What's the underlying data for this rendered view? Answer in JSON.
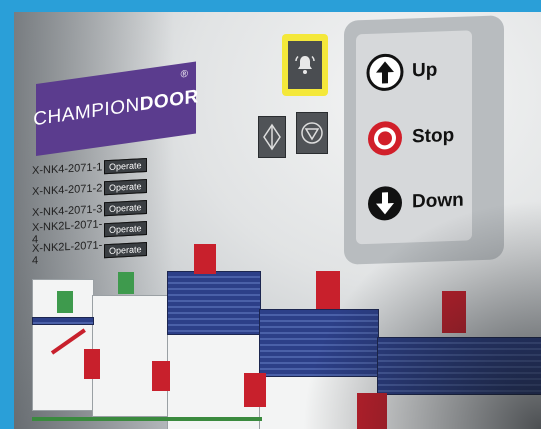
{
  "brand": {
    "name_part1": "CHAMPION",
    "name_part2": "DOOR",
    "registered": "®"
  },
  "devices": [
    {
      "name": "X-NK4-2071-1",
      "button": "Operate"
    },
    {
      "name": "X-NK4-2071-2",
      "button": "Operate"
    },
    {
      "name": "X-NK4-2071-3",
      "button": "Operate"
    },
    {
      "name": "X-NK2L-2071-4",
      "button": "Operate"
    },
    {
      "name": "X-NK2L-2071-4",
      "button": "Operate"
    }
  ],
  "controls": {
    "up": "Up",
    "stop": "Stop",
    "down": "Down"
  },
  "colors": {
    "frame": "#2a9fd8",
    "brand": "#5b3c8e",
    "alarm": "#f4e83a",
    "shutter": "#2c3f88",
    "red": "#c8202c",
    "green": "#3e9a4d"
  },
  "icons": [
    "bell-icon",
    "open-close-icon",
    "close-icon",
    "arrow-up-icon",
    "stop-icon",
    "arrow-down-icon"
  ]
}
